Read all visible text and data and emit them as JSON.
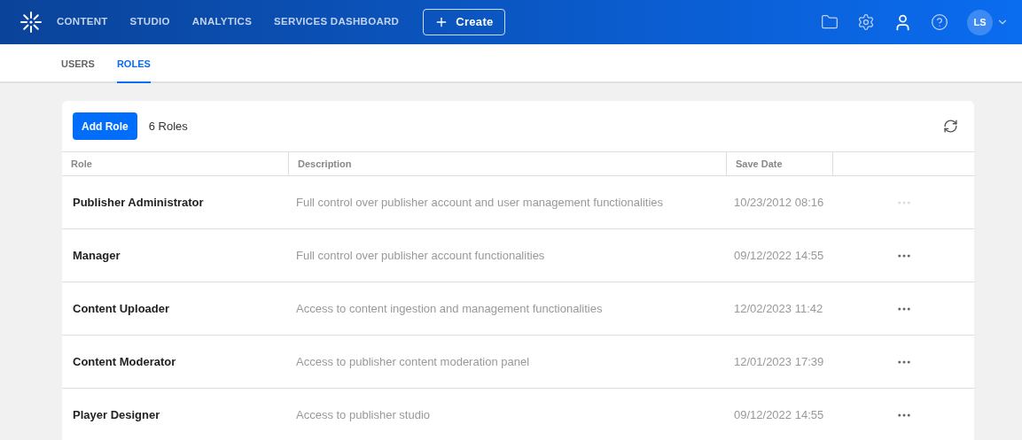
{
  "nav": {
    "items": [
      {
        "label": "CONTENT",
        "selected": false
      },
      {
        "label": "STUDIO",
        "selected": false
      },
      {
        "label": "ANALYTICS",
        "selected": false
      },
      {
        "label": "SERVICES DASHBOARD",
        "selected": false
      }
    ],
    "create_button": "Create",
    "avatar": "LS"
  },
  "tabs": [
    {
      "label": "USERS",
      "selected": false
    },
    {
      "label": "ROLES",
      "selected": true
    }
  ],
  "toolbar": {
    "add_button": "Add Role",
    "count": "6 Roles"
  },
  "table": {
    "columns": [
      "Role",
      "Description",
      "Save Date"
    ],
    "rows": [
      {
        "role": "Publisher Administrator",
        "description": "Full control over publisher account and user management functionalities",
        "save_date": "10/23/2012 08:16",
        "actions_disabled": true
      },
      {
        "role": "Manager",
        "description": "Full control over publisher account functionalities",
        "save_date": "09/12/2022 14:55",
        "actions_disabled": false
      },
      {
        "role": "Content Uploader",
        "description": "Access to content ingestion and management functionalities",
        "save_date": "12/02/2023 11:42",
        "actions_disabled": false
      },
      {
        "role": "Content Moderator",
        "description": "Access to publisher content moderation panel",
        "save_date": "12/01/2023 17:39",
        "actions_disabled": false
      },
      {
        "role": "Player Designer",
        "description": "Access to publisher studio",
        "save_date": "09/12/2022 14:55",
        "actions_disabled": false
      }
    ]
  }
}
